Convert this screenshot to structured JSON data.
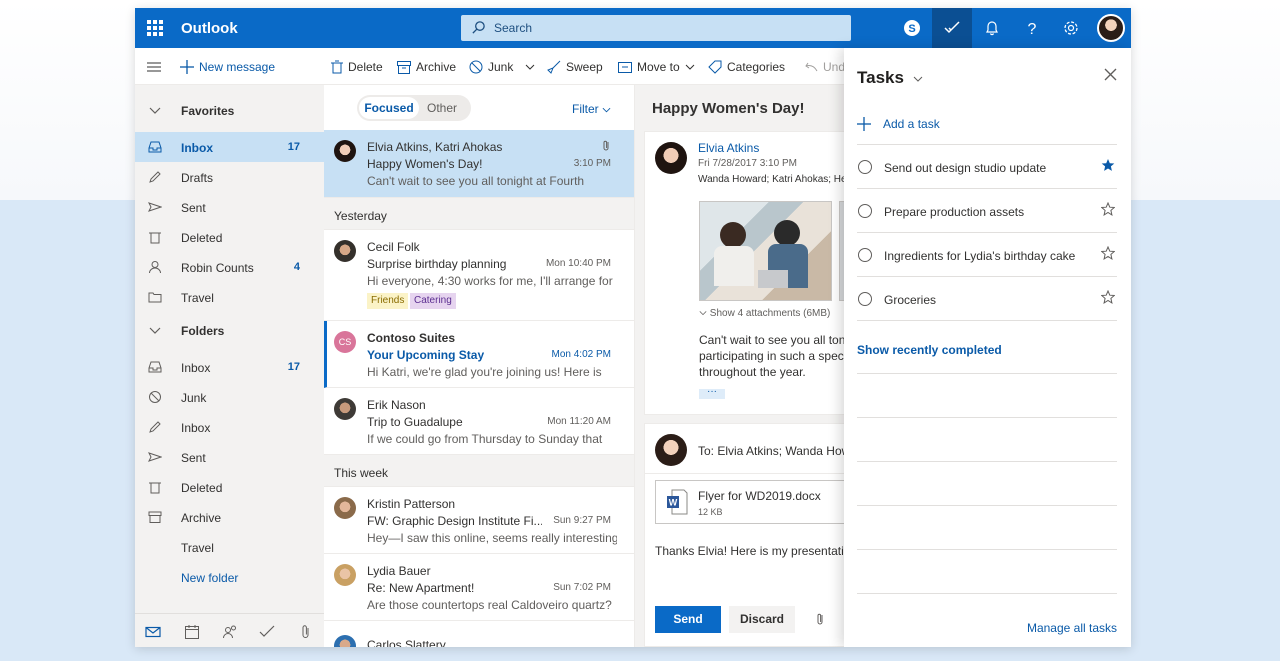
{
  "topbar": {
    "app_name": "Outlook",
    "search_placeholder": "Search",
    "accent": "#0a6ac7"
  },
  "commands": {
    "new_message": "New message",
    "delete": "Delete",
    "archive": "Archive",
    "junk": "Junk",
    "sweep": "Sweep",
    "move_to": "Move to",
    "categories": "Categories",
    "undo": "Undo"
  },
  "nav": {
    "favorites": "Favorites",
    "folders": "Folders",
    "fav_items": [
      {
        "label": "Inbox",
        "count": "17"
      },
      {
        "label": "Drafts",
        "count": ""
      },
      {
        "label": "Sent",
        "count": ""
      },
      {
        "label": "Deleted",
        "count": ""
      },
      {
        "label": "Robin Counts",
        "count": "4"
      },
      {
        "label": "Travel",
        "count": ""
      }
    ],
    "folder_items": [
      {
        "label": "Inbox",
        "count": "17"
      },
      {
        "label": "Junk",
        "count": ""
      },
      {
        "label": "Inbox",
        "count": ""
      },
      {
        "label": "Sent",
        "count": ""
      },
      {
        "label": "Deleted",
        "count": ""
      },
      {
        "label": "Archive",
        "count": ""
      },
      {
        "label": "Travel",
        "count": ""
      }
    ],
    "new_folder": "New folder"
  },
  "list": {
    "focused": "Focused",
    "other": "Other",
    "filter": "Filter",
    "groups": [
      "Yesterday",
      "This week"
    ],
    "messages": [
      {
        "from": "Elvia Atkins, Katri Ahokas",
        "subject": "Happy Women's Day!",
        "time": "3:10 PM",
        "preview": "Can't wait to see you all tonight at Fourth"
      },
      {
        "from": "Cecil Folk",
        "subject": "Surprise birthday planning",
        "time": "Mon 10:40 PM",
        "preview": "Hi everyone, 4:30 works for me, I'll arrange for",
        "tags": [
          "Friends",
          "Catering"
        ]
      },
      {
        "from": "Contoso Suites",
        "initials": "CS",
        "subject": "Your Upcoming Stay",
        "time": "Mon 4:02 PM",
        "preview": "Hi Katri, we're glad you're joining us! Here is"
      },
      {
        "from": "Erik Nason",
        "subject": "Trip to Guadalupe",
        "time": "Mon 11:20 AM",
        "preview": "If we could go from Thursday to Sunday that"
      },
      {
        "from": "Kristin Patterson",
        "subject": "FW: Graphic Design Institute Fi...",
        "time": "Sun 9:27 PM",
        "preview": "Hey—I saw this online, seems really interesting."
      },
      {
        "from": "Lydia Bauer",
        "subject": "Re: New Apartment!",
        "time": "Sun 7:02 PM",
        "preview": "Are those countertops real Caldoveiro quartz?"
      },
      {
        "from": "Carlos Slattery",
        "subject": "",
        "time": "",
        "preview": ""
      }
    ]
  },
  "reading": {
    "title": "Happy Women's Day!",
    "sender": "Elvia Atkins",
    "date": "Fri 7/28/2017 3:10 PM",
    "recipients": "Wanda Howard; Katri Ahokas; He",
    "attachments": "Show 4 attachments (6MB)",
    "body_lines": [
      "Can't wait to see you all toni",
      "participating in such a specia",
      "throughout the year."
    ],
    "reply_to": "To: Elvia Atkins; Wanda Howa",
    "file_name": "Flyer for WD2019.docx",
    "file_size": "12 KB",
    "reply_body": "Thanks Elvia! Here is my presentation",
    "send": "Send",
    "discard": "Discard"
  },
  "tasks": {
    "title": "Tasks",
    "add_task": "Add a task",
    "items": [
      {
        "label": "Send out design studio update",
        "starred": true
      },
      {
        "label": "Prepare production assets",
        "starred": false
      },
      {
        "label": "Ingredients for Lydia's birthday cake",
        "starred": false
      },
      {
        "label": "Groceries",
        "starred": false
      }
    ],
    "show_completed": "Show recently completed",
    "manage": "Manage all tasks"
  }
}
